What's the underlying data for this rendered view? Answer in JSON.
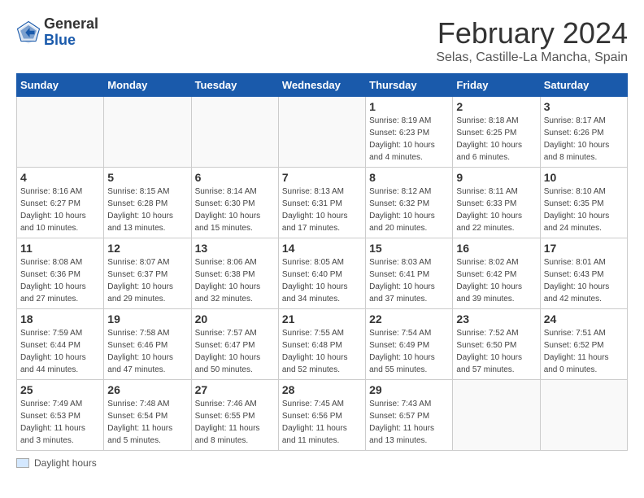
{
  "header": {
    "logo_general": "General",
    "logo_blue": "Blue",
    "month_year": "February 2024",
    "location": "Selas, Castille-La Mancha, Spain"
  },
  "legend": {
    "label": "Daylight hours"
  },
  "columns": [
    "Sunday",
    "Monday",
    "Tuesday",
    "Wednesday",
    "Thursday",
    "Friday",
    "Saturday"
  ],
  "weeks": [
    [
      {
        "day": "",
        "info": ""
      },
      {
        "day": "",
        "info": ""
      },
      {
        "day": "",
        "info": ""
      },
      {
        "day": "",
        "info": ""
      },
      {
        "day": "1",
        "info": "Sunrise: 8:19 AM\nSunset: 6:23 PM\nDaylight: 10 hours\nand 4 minutes."
      },
      {
        "day": "2",
        "info": "Sunrise: 8:18 AM\nSunset: 6:25 PM\nDaylight: 10 hours\nand 6 minutes."
      },
      {
        "day": "3",
        "info": "Sunrise: 8:17 AM\nSunset: 6:26 PM\nDaylight: 10 hours\nand 8 minutes."
      }
    ],
    [
      {
        "day": "4",
        "info": "Sunrise: 8:16 AM\nSunset: 6:27 PM\nDaylight: 10 hours\nand 10 minutes."
      },
      {
        "day": "5",
        "info": "Sunrise: 8:15 AM\nSunset: 6:28 PM\nDaylight: 10 hours\nand 13 minutes."
      },
      {
        "day": "6",
        "info": "Sunrise: 8:14 AM\nSunset: 6:30 PM\nDaylight: 10 hours\nand 15 minutes."
      },
      {
        "day": "7",
        "info": "Sunrise: 8:13 AM\nSunset: 6:31 PM\nDaylight: 10 hours\nand 17 minutes."
      },
      {
        "day": "8",
        "info": "Sunrise: 8:12 AM\nSunset: 6:32 PM\nDaylight: 10 hours\nand 20 minutes."
      },
      {
        "day": "9",
        "info": "Sunrise: 8:11 AM\nSunset: 6:33 PM\nDaylight: 10 hours\nand 22 minutes."
      },
      {
        "day": "10",
        "info": "Sunrise: 8:10 AM\nSunset: 6:35 PM\nDaylight: 10 hours\nand 24 minutes."
      }
    ],
    [
      {
        "day": "11",
        "info": "Sunrise: 8:08 AM\nSunset: 6:36 PM\nDaylight: 10 hours\nand 27 minutes."
      },
      {
        "day": "12",
        "info": "Sunrise: 8:07 AM\nSunset: 6:37 PM\nDaylight: 10 hours\nand 29 minutes."
      },
      {
        "day": "13",
        "info": "Sunrise: 8:06 AM\nSunset: 6:38 PM\nDaylight: 10 hours\nand 32 minutes."
      },
      {
        "day": "14",
        "info": "Sunrise: 8:05 AM\nSunset: 6:40 PM\nDaylight: 10 hours\nand 34 minutes."
      },
      {
        "day": "15",
        "info": "Sunrise: 8:03 AM\nSunset: 6:41 PM\nDaylight: 10 hours\nand 37 minutes."
      },
      {
        "day": "16",
        "info": "Sunrise: 8:02 AM\nSunset: 6:42 PM\nDaylight: 10 hours\nand 39 minutes."
      },
      {
        "day": "17",
        "info": "Sunrise: 8:01 AM\nSunset: 6:43 PM\nDaylight: 10 hours\nand 42 minutes."
      }
    ],
    [
      {
        "day": "18",
        "info": "Sunrise: 7:59 AM\nSunset: 6:44 PM\nDaylight: 10 hours\nand 44 minutes."
      },
      {
        "day": "19",
        "info": "Sunrise: 7:58 AM\nSunset: 6:46 PM\nDaylight: 10 hours\nand 47 minutes."
      },
      {
        "day": "20",
        "info": "Sunrise: 7:57 AM\nSunset: 6:47 PM\nDaylight: 10 hours\nand 50 minutes."
      },
      {
        "day": "21",
        "info": "Sunrise: 7:55 AM\nSunset: 6:48 PM\nDaylight: 10 hours\nand 52 minutes."
      },
      {
        "day": "22",
        "info": "Sunrise: 7:54 AM\nSunset: 6:49 PM\nDaylight: 10 hours\nand 55 minutes."
      },
      {
        "day": "23",
        "info": "Sunrise: 7:52 AM\nSunset: 6:50 PM\nDaylight: 10 hours\nand 57 minutes."
      },
      {
        "day": "24",
        "info": "Sunrise: 7:51 AM\nSunset: 6:52 PM\nDaylight: 11 hours\nand 0 minutes."
      }
    ],
    [
      {
        "day": "25",
        "info": "Sunrise: 7:49 AM\nSunset: 6:53 PM\nDaylight: 11 hours\nand 3 minutes."
      },
      {
        "day": "26",
        "info": "Sunrise: 7:48 AM\nSunset: 6:54 PM\nDaylight: 11 hours\nand 5 minutes."
      },
      {
        "day": "27",
        "info": "Sunrise: 7:46 AM\nSunset: 6:55 PM\nDaylight: 11 hours\nand 8 minutes."
      },
      {
        "day": "28",
        "info": "Sunrise: 7:45 AM\nSunset: 6:56 PM\nDaylight: 11 hours\nand 11 minutes."
      },
      {
        "day": "29",
        "info": "Sunrise: 7:43 AM\nSunset: 6:57 PM\nDaylight: 11 hours\nand 13 minutes."
      },
      {
        "day": "",
        "info": ""
      },
      {
        "day": "",
        "info": ""
      }
    ]
  ]
}
